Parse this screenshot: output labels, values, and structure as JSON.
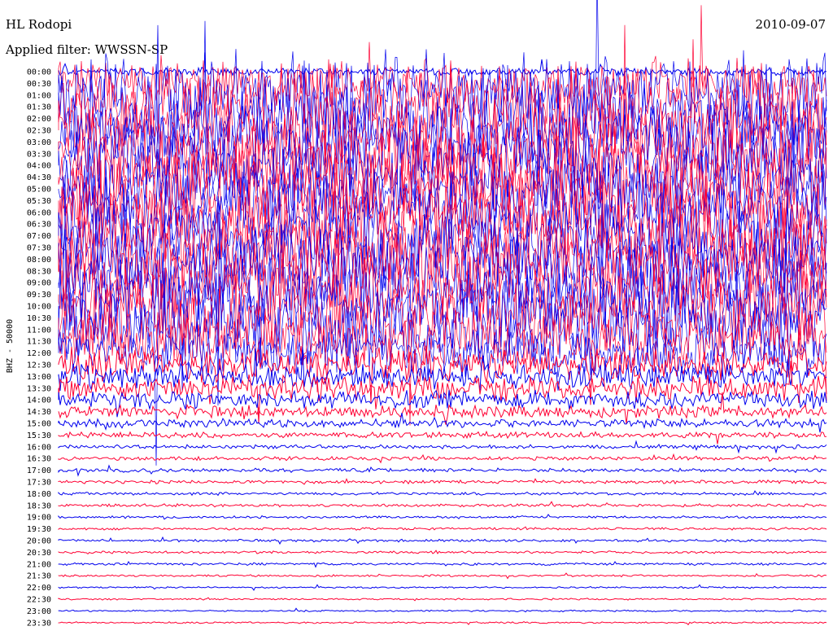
{
  "header": {
    "station": "HL Rodopi",
    "filter_line": "Applied filter: WWSSN-SP",
    "date": "2010-09-07"
  },
  "chart_data": {
    "type": "line",
    "subtype": "helicorder",
    "title": "HL Rodopi",
    "date": "2010-09-07",
    "filter": "Applied filter: WWSSN-SP",
    "ylabel": "BHZ - 50000",
    "y_tick_labels": [
      "00:00",
      "00:30",
      "01:00",
      "01:30",
      "02:00",
      "02:30",
      "03:00",
      "03:30",
      "04:00",
      "04:30",
      "05:00",
      "05:30",
      "06:00",
      "06:30",
      "07:00",
      "07:30",
      "08:00",
      "08:30",
      "09:00",
      "09:30",
      "10:00",
      "10:30",
      "11:00",
      "11:30",
      "12:00",
      "12:30",
      "13:00",
      "13:30",
      "14:00",
      "14:30",
      "15:00",
      "15:30",
      "16:00",
      "16:30",
      "17:00",
      "17:30",
      "18:00",
      "18:30",
      "19:00",
      "19:30",
      "20:00",
      "20:30",
      "21:00",
      "21:30",
      "22:00",
      "22:30",
      "23:00",
      "23:30"
    ],
    "line_minutes": 30,
    "trace_colors": [
      "#0000ee",
      "#ff0033"
    ],
    "relative_amplitude": [
      0.1,
      0.6,
      1.0,
      1.0,
      1.0,
      1.0,
      1.0,
      1.0,
      1.0,
      1.0,
      1.0,
      1.0,
      1.0,
      1.0,
      1.0,
      1.0,
      1.0,
      1.0,
      1.0,
      1.0,
      1.0,
      1.0,
      1.0,
      0.7,
      0.55,
      0.4,
      0.3,
      0.3,
      0.22,
      0.15,
      0.1,
      0.07,
      0.05,
      0.045,
      0.045,
      0.04,
      0.035,
      0.035,
      0.03,
      0.03,
      0.03,
      0.03,
      0.03,
      0.025,
      0.02,
      0.02,
      0.02,
      0.02
    ],
    "grid": false,
    "legend": "none"
  }
}
